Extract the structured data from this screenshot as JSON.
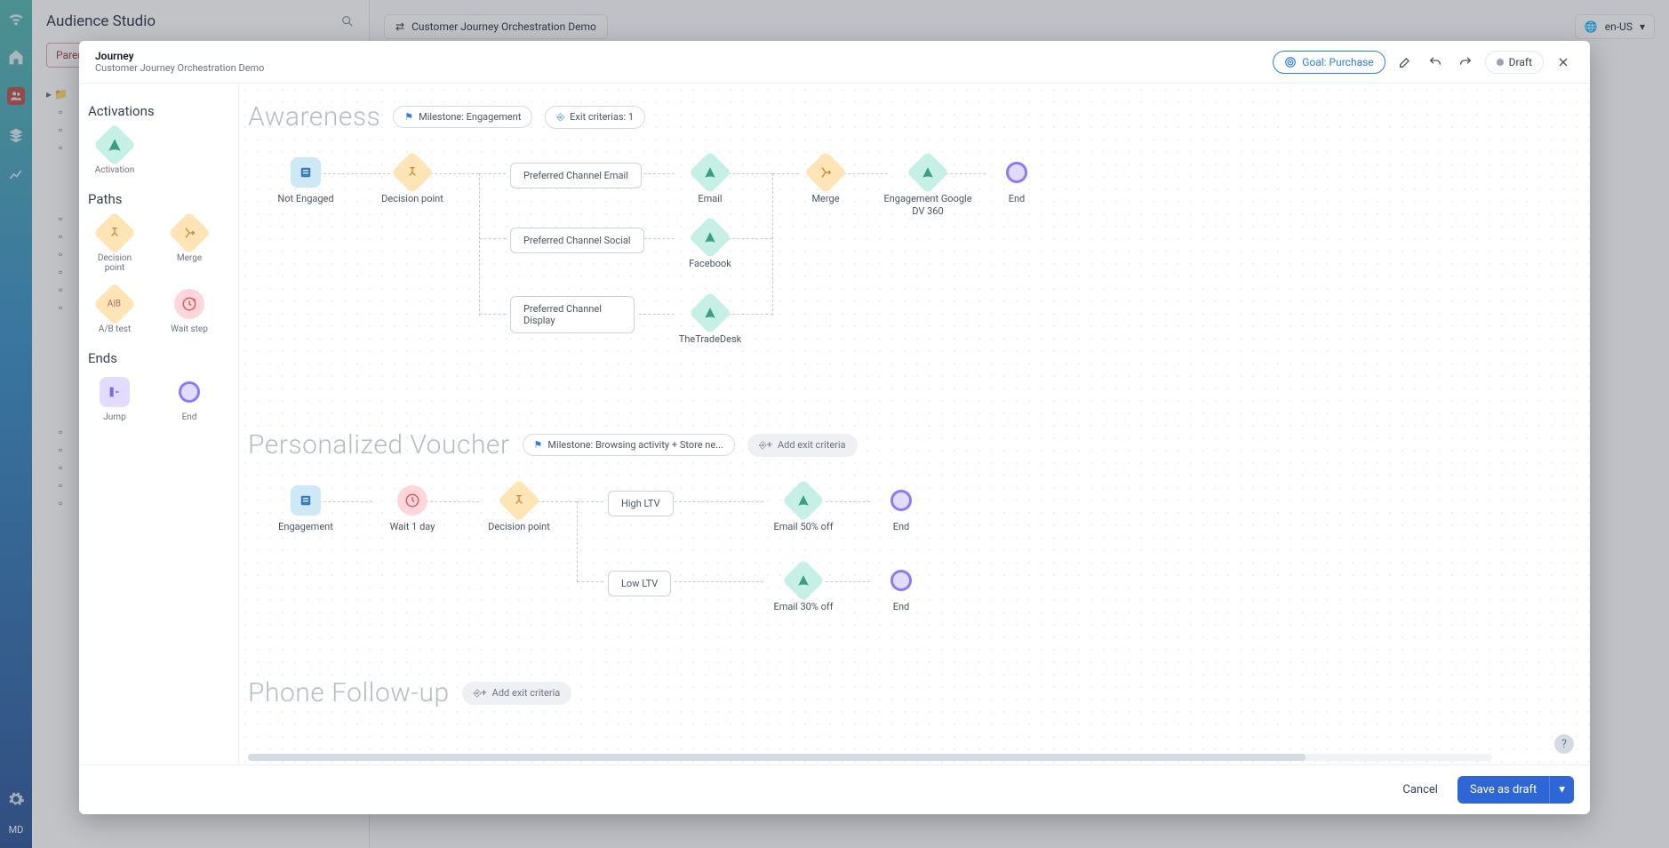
{
  "app": {
    "title": "Audience Studio"
  },
  "language": "en-US",
  "breadcrumb_chip": "Paren\nReta",
  "tab": {
    "label": "Customer Journey Orchestration Demo"
  },
  "modal": {
    "kicker": "Journey",
    "subtitle": "Customer Journey Orchestration Demo",
    "goal": "Goal: Purchase",
    "status": "Draft",
    "palette": {
      "sections": {
        "activations": "Activations",
        "paths": "Paths",
        "ends": "Ends"
      },
      "items": {
        "activation": "Activation",
        "decision": "Decision point",
        "merge": "Merge",
        "ab": "A/B test",
        "wait": "Wait step",
        "jump": "Jump",
        "end": "End"
      }
    },
    "stages": {
      "awareness": {
        "title": "Awareness",
        "milestone": "Milestone: Engagement",
        "exit": "Exit criterias: 1",
        "nodes": {
          "not_engaged": "Not Engaged",
          "decision": "Decision point",
          "b_email": "Preferred Channel Email",
          "b_social": "Preferred Channel Social",
          "b_display": "Preferred Channel Display",
          "email": "Email",
          "facebook": "Facebook",
          "tradedesk": "TheTradeDesk",
          "merge": "Merge",
          "engagement": "Engagement Google DV 360",
          "end": "End"
        }
      },
      "voucher": {
        "title": "Personalized Voucher",
        "milestone": "Milestone: Browsing activity + Store ne...",
        "add_exit": "Add exit criteria",
        "nodes": {
          "engagement": "Engagement",
          "wait": "Wait 1 day",
          "decision": "Decision point",
          "high_ltv": "High LTV",
          "low_ltv": "Low LTV",
          "email50": "Email 50% off",
          "email30": "Email 30% off",
          "end": "End"
        }
      },
      "phone": {
        "title": "Phone Follow-up",
        "add_exit": "Add exit criteria"
      }
    },
    "footer": {
      "cancel": "Cancel",
      "save": "Save as draft"
    }
  }
}
